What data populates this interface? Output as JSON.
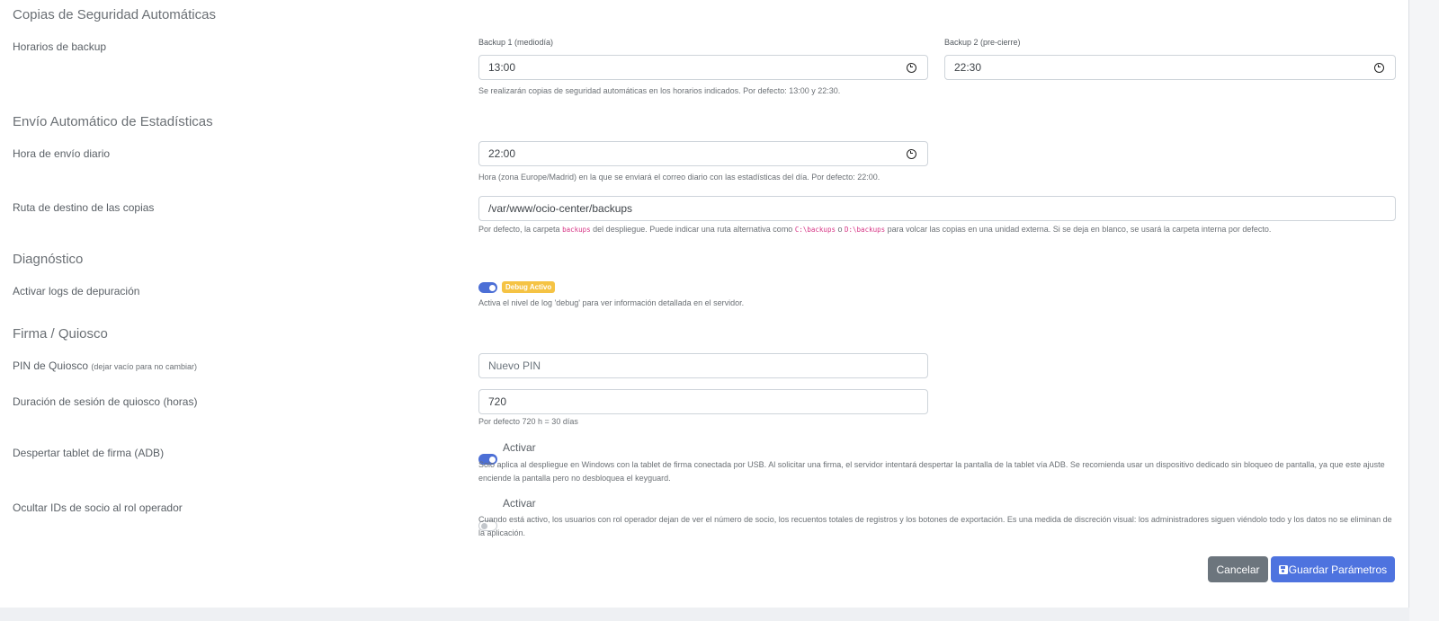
{
  "backups": {
    "section_title": "Copias de Seguridad Automáticas",
    "schedule_label": "Horarios de backup",
    "backup1_label": "Backup 1 (mediodía)",
    "backup1_value": "13:00",
    "backup2_label": "Backup 2 (pre-cierre)",
    "backup2_value": "22:30",
    "help": "Se realizarán copias de seguridad automáticas en los horarios indicados. Por defecto: 13:00 y 22:30."
  },
  "stats": {
    "section_title": "Envío Automático de Estadísticas",
    "send_time_label": "Hora de envío diario",
    "send_time_value": "22:00",
    "send_time_help": "Hora (zona Europe/Madrid) en la que se enviará el correo diario con las estadísticas del día. Por defecto: 22:00.",
    "path_label": "Ruta de destino de las copias",
    "path_value": "/var/www/ocio-center/backups",
    "path_help": {
      "p1": "Por defecto, la carpeta ",
      "code1": "backups",
      "p2": " del despliegue. Puede indicar una ruta alternativa como ",
      "code2": "C:\\backups",
      "p3": " o ",
      "code3": "D:\\backups",
      "p4": " para volcar las copias en una unidad externa. Si se deja en blanco, se usará la carpeta interna por defecto."
    }
  },
  "diagnostics": {
    "section_title": "Diagnóstico",
    "debug_label": "Activar logs de depuración",
    "debug_badge": "Debug Activo",
    "debug_help": "Activa el nivel de log 'debug' para ver información detallada en el servidor."
  },
  "kiosk": {
    "section_title": "Firma / Quiosco",
    "pin_label": "PIN de Quiosco",
    "pin_hint": "(dejar vacío para no cambiar)",
    "pin_placeholder": "Nuevo PIN",
    "session_label": "Duración de sesión de quiosco (horas)",
    "session_value": "720",
    "session_help": "Por defecto 720 h = 30 días",
    "adb_label": "Despertar tablet de firma (ADB)",
    "adb_toggle_label": "Activar",
    "adb_help": "Solo aplica al despliegue en Windows con la tablet de firma conectada por USB. Al solicitar una firma, el servidor intentará despertar la pantalla de la tablet vía ADB. Se recomienda usar un dispositivo dedicado sin bloqueo de pantalla, ya que este ajuste enciende la pantalla pero no desbloquea el keyguard.",
    "hide_ids_label": "Ocultar IDs de socio al rol operador",
    "hide_ids_toggle_label": "Activar",
    "hide_ids_help": "Cuando está activo, los usuarios con rol operador dejan de ver el número de socio, los recuentos totales de registros y los botones de exportación. Es una medida de discreción visual: los administradores siguen viéndolo todo y los datos no se eliminan de la aplicación."
  },
  "actions": {
    "cancel_label": "Cancelar",
    "save_label": "Guardar Parámetros"
  },
  "toggles": {
    "debug": true,
    "adb": true,
    "hide_ids": false
  }
}
